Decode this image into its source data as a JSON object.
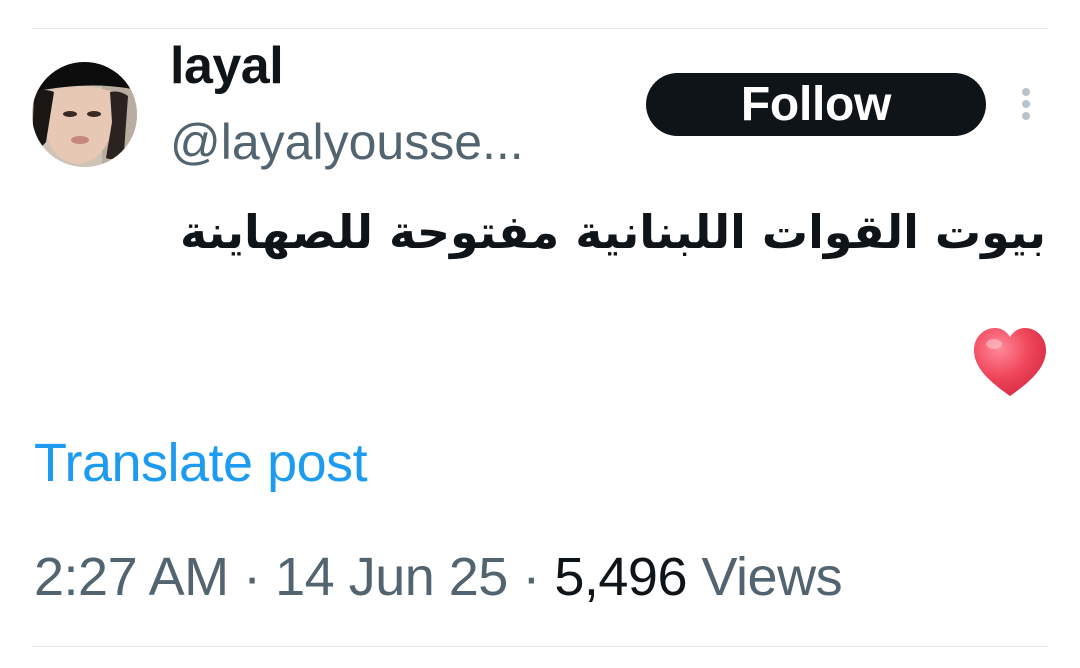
{
  "author": {
    "display_name": "layal",
    "handle": "@layalyousse..."
  },
  "actions": {
    "follow_label": "Follow",
    "more_icon": "more-vertical-icon"
  },
  "post": {
    "text": "بيوت القوات اللبنانية مفتوحة للصهاينة",
    "emoji_icon": "red-heart-icon"
  },
  "translate": {
    "label": "Translate post"
  },
  "meta": {
    "time": "2:27 AM",
    "separator": "·",
    "date": "14 Jun 25",
    "views_count": "5,496",
    "views_label": "Views"
  },
  "colors": {
    "link": "#1d9bf0",
    "secondary_text": "#536471",
    "primary_text": "#0f1419",
    "follow_bg": "#0f1419",
    "heart": "#f0475b"
  }
}
